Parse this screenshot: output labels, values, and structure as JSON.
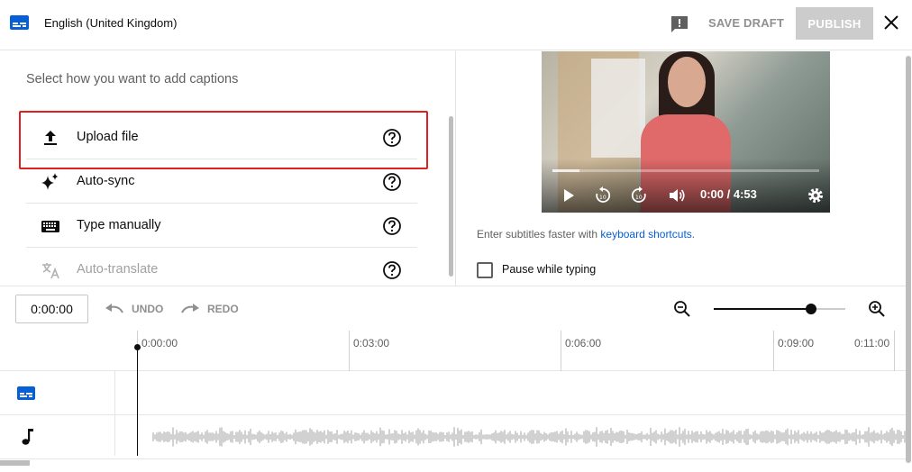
{
  "header": {
    "language": "English (United Kingdom)",
    "save_draft": "SAVE DRAFT",
    "publish": "PUBLISH",
    "icons": {
      "captions": "closed-captions-icon",
      "feedback": "feedback-icon",
      "close": "close-icon"
    }
  },
  "left": {
    "prompt": "Select how you want to add captions",
    "options": [
      {
        "label": "Upload file",
        "icon": "upload-icon",
        "highlighted": true
      },
      {
        "label": "Auto-sync",
        "icon": "sparkle-icon"
      },
      {
        "label": "Type manually",
        "icon": "keyboard-icon"
      },
      {
        "label": "Auto-translate",
        "icon": "translate-icon",
        "disabled": true
      }
    ]
  },
  "player": {
    "time": "0:00 / 4:53",
    "progress": 0.1
  },
  "tips": {
    "shortcuts_prefix": "Enter subtitles faster with ",
    "shortcuts_link": "keyboard shortcuts",
    "shortcuts_suffix": ".",
    "pause_label": "Pause while typing",
    "pause_checked": false
  },
  "timeline": {
    "current_time": "0:00:00",
    "undo": "UNDO",
    "redo": "REDO",
    "zoom_level": 0.74,
    "ticks": [
      "0:00:00",
      "0:03:00",
      "0:06:00",
      "0:09:00",
      "0:11:00"
    ]
  },
  "colors": {
    "accent": "#065fd4",
    "highlight": "#e02020",
    "disabled_button": "#cccccc"
  }
}
